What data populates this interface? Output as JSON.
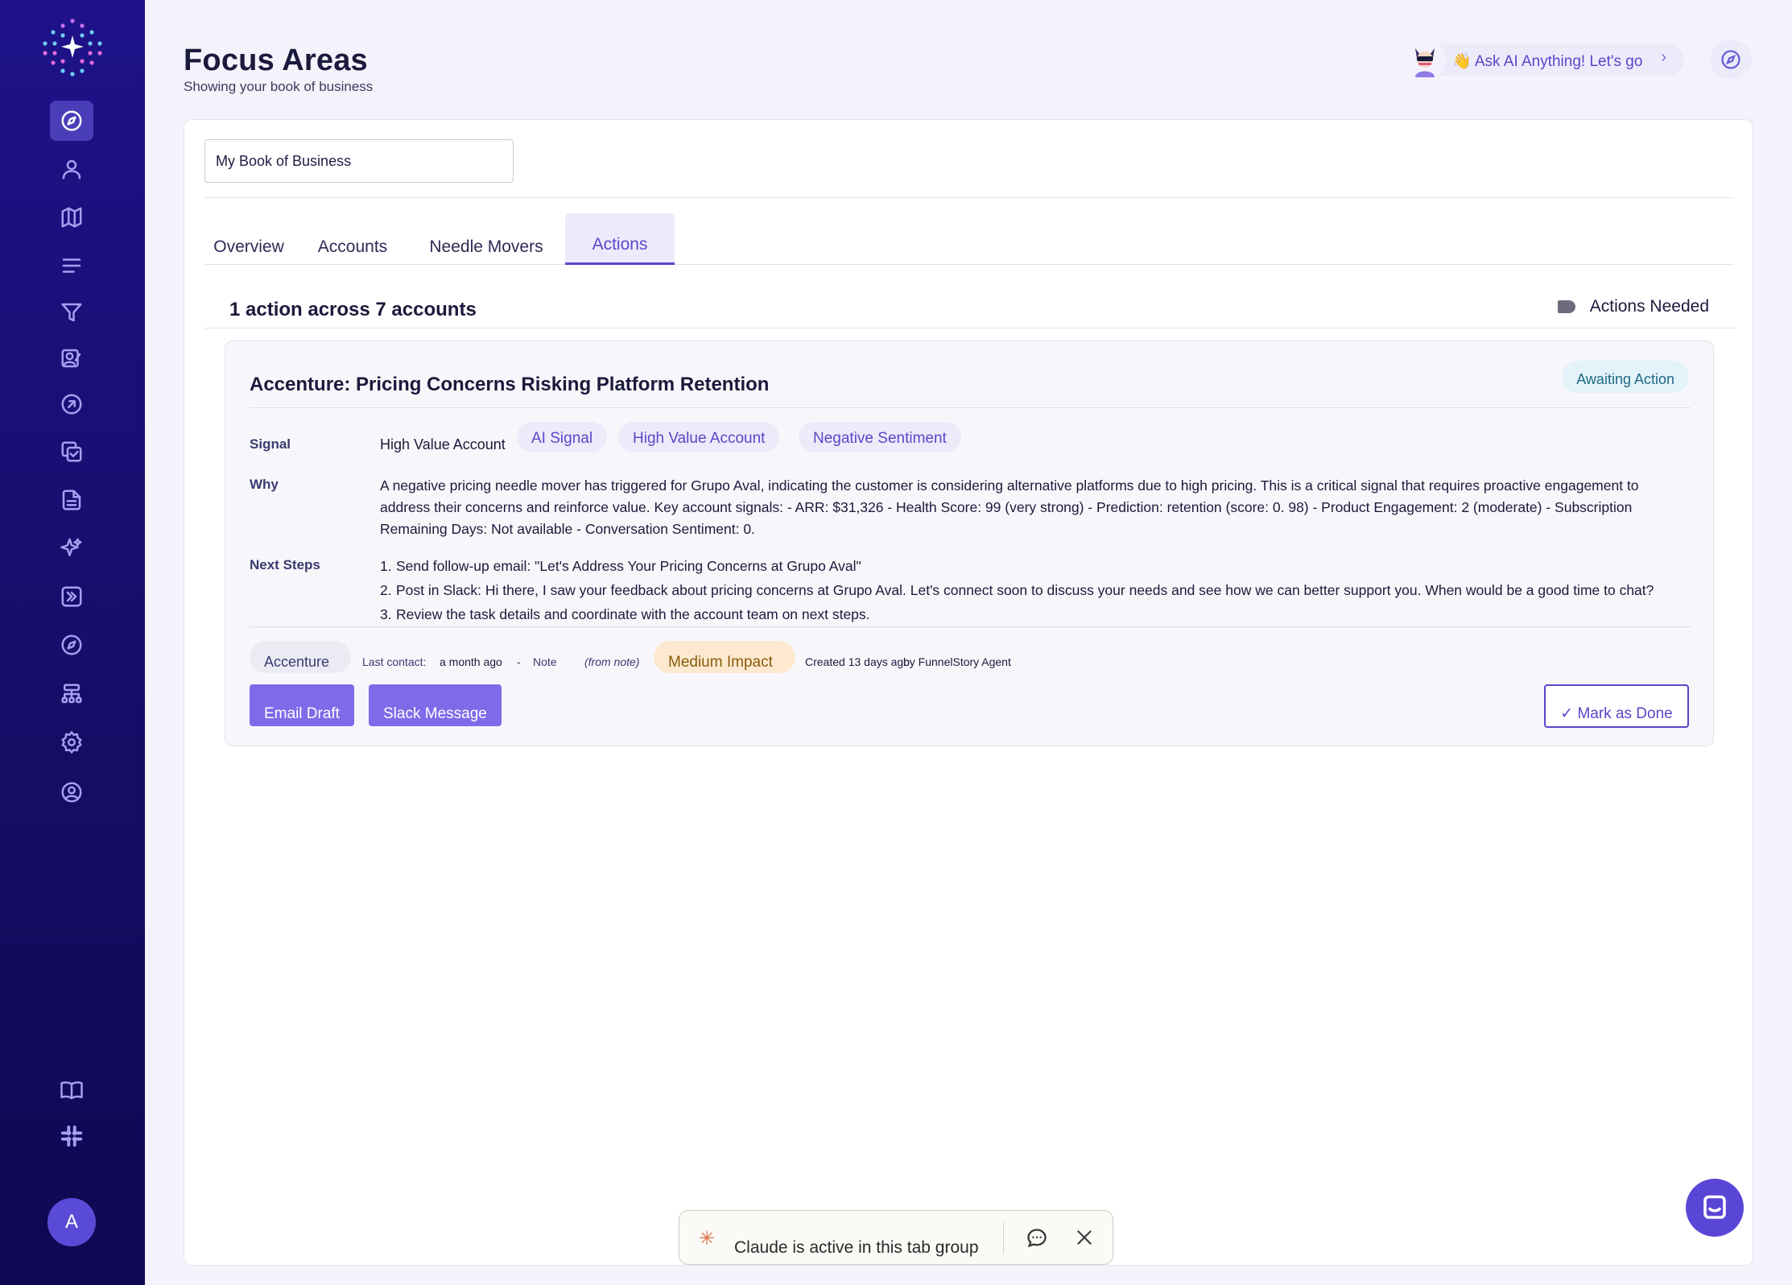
{
  "header": {
    "title": "Focus Areas",
    "subtitle": "Showing your book of business",
    "ask_ai_label": "👋 Ask AI Anything! Let's go",
    "ask_ai_chevron": "›"
  },
  "sidebar": {
    "user_initial": "A",
    "items": [
      {
        "name": "compass",
        "active": true
      },
      {
        "name": "user"
      },
      {
        "name": "map"
      },
      {
        "name": "list"
      },
      {
        "name": "filter"
      },
      {
        "name": "contact-edit"
      },
      {
        "name": "arrow-up-right-circle"
      },
      {
        "name": "copy-check"
      },
      {
        "name": "file-text"
      },
      {
        "name": "sparkles"
      },
      {
        "name": "chevrons-right-square"
      },
      {
        "name": "compass-secondary"
      },
      {
        "name": "hierarchy"
      },
      {
        "name": "settings"
      },
      {
        "name": "user-circle"
      },
      {
        "name": "book-open"
      },
      {
        "name": "slack"
      }
    ]
  },
  "filters": {
    "book_select_value": "My Book of Business"
  },
  "tabs": [
    {
      "label": "Overview",
      "active": false
    },
    {
      "label": "Accounts",
      "active": false
    },
    {
      "label": "Needle Movers",
      "active": false
    },
    {
      "label": "Actions",
      "active": true
    }
  ],
  "summary": {
    "text": "1 action across 7 accounts",
    "actions_filter_label": "Actions Needed"
  },
  "action_card": {
    "title": "Accenture: Pricing Concerns Risking Platform Retention",
    "status": "Awaiting Action",
    "signal_label": "Signal",
    "signal_value": "High Value Account",
    "signal_chips": [
      "AI Signal",
      "High Value Account",
      "Negative Sentiment"
    ],
    "why_label": "Why",
    "why_text": "A negative pricing needle mover has triggered for Grupo Aval, indicating the customer is considering alternative platforms due to high pricing. This is a critical signal that requires proactive engagement to address their concerns and reinforce value. Key account signals: - ARR: $31,326 - Health Score: 99 (very strong) - Prediction: retention (score: 0. 98) - Product Engagement: 2 (moderate) - Subscription Remaining Days: Not available - Conversation Sentiment: 0.",
    "next_steps_label": "Next Steps",
    "next_steps": [
      {
        "num": "1.",
        "text": "Send follow-up email: \"Let's Address Your Pricing Concerns at Grupo Aval\""
      },
      {
        "num": "2.",
        "text": "Post in Slack: Hi there, I saw your feedback about pricing concerns at Grupo Aval. Let's connect soon to discuss your needs and see how we can better support you. When would be a good time to chat?"
      },
      {
        "num": "3.",
        "text": "Review the task details and coordinate with the account team on next steps."
      }
    ],
    "meta": {
      "company": "Accenture",
      "last_contact_label": "Last contact:",
      "last_contact_value": "a month ago",
      "separator": "-",
      "note_label": "Note",
      "note_source": "(from note)",
      "impact": "Medium Impact",
      "created": "Created 13 days ago",
      "created_by": "by FunnelStory Agent"
    },
    "buttons": {
      "email_draft": "Email Draft",
      "slack_message": "Slack Message",
      "mark_done": "✓ Mark as Done"
    }
  },
  "claude_bar": {
    "text": "Claude is active in this tab group"
  },
  "colors": {
    "sidebar_bg": "#1f128a",
    "accent": "#5a46c9",
    "primary_button": "#7d6be9",
    "impact_bg": "#fde9cf",
    "status_bg": "#e4f2fa"
  }
}
